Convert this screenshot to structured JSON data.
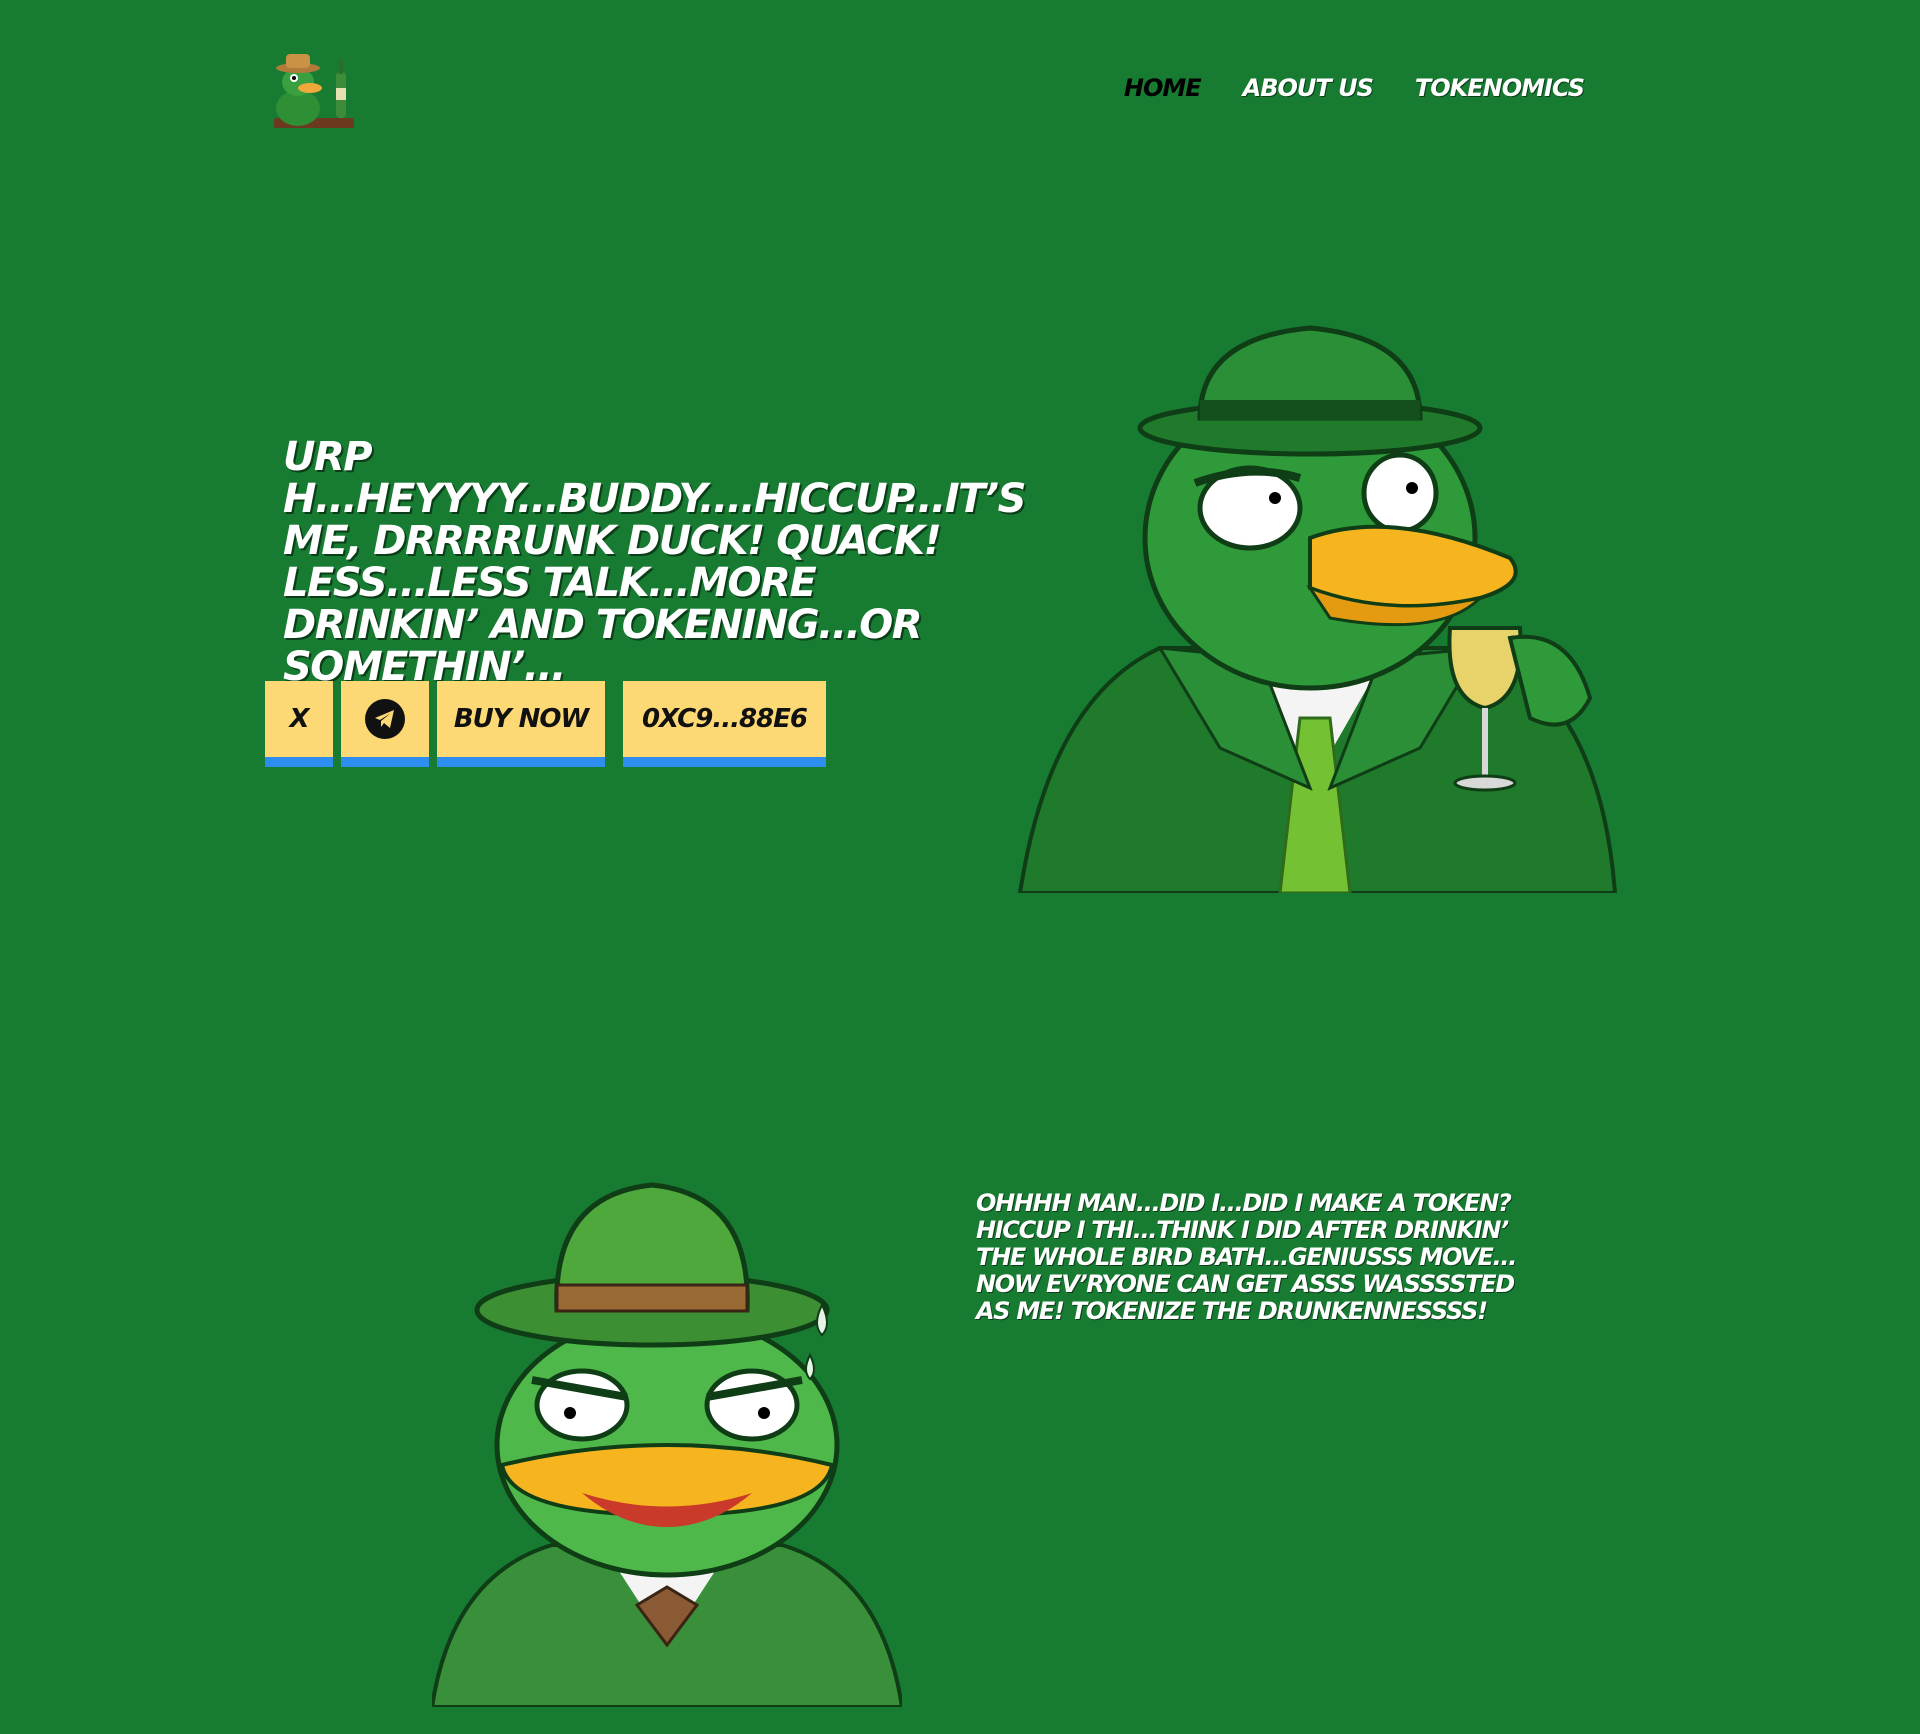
{
  "header": {
    "logo_icon": "drunk-duck-logo",
    "nav": [
      {
        "label": "HOME",
        "active": true
      },
      {
        "label": "ABOUT US",
        "active": false
      },
      {
        "label": "TOKENOMICS",
        "active": false
      }
    ]
  },
  "hero": {
    "title": "URP H...HEYYYY...BUDDY....HICCUP...IT’S ME, DRRRRUNK DUCK! QUACK! LESS...LESS TALK...MORE DRINKIN’ AND TOKENING...OR SOMETHIN’...",
    "buttons": {
      "x_label": "X",
      "telegram_icon": "telegram-icon",
      "buy_label": "BUY NOW",
      "contract_label": "0XC9...88E6"
    },
    "image_icon": "duck-with-champagne-illustration"
  },
  "about": {
    "text": "OHHHH MAN...DID I...DID I MAKE A TOKEN? HICCUP I THI...THINK I DID AFTER DRINKIN’ THE WHOLE BIRD BATH...GENIUSSS MOVE... NOW EV’RYONE CAN GET ASSS WASSSSTED AS ME! TOKENIZE THE DRUNKENNESSSS!",
    "image_icon": "frog-duck-in-hat-illustration"
  },
  "colors": {
    "background": "#177b32",
    "button_bg": "#fcd975",
    "button_border": "#2e8ef0",
    "text": "#ffffff"
  }
}
